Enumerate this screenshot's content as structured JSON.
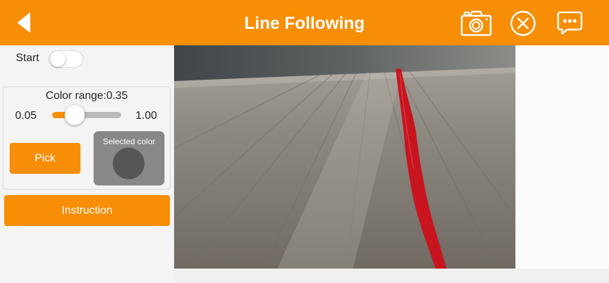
{
  "header": {
    "title": "Line Following",
    "icons": [
      "back-arrow-icon",
      "camera-icon",
      "close-circle-icon",
      "chat-more-icon"
    ]
  },
  "controls": {
    "start_label": "Start",
    "start_toggle": false,
    "color_range_label": "Color range:0.35",
    "range_value": 0.35,
    "range_min": "0.05",
    "range_max": "1.00",
    "pick_label": "Pick",
    "selected_color_label": "Selected color",
    "selected_color": "#555555",
    "instruction_label": "Instruction"
  },
  "colors": {
    "accent": "#f78e06",
    "line": "#c8141f"
  }
}
